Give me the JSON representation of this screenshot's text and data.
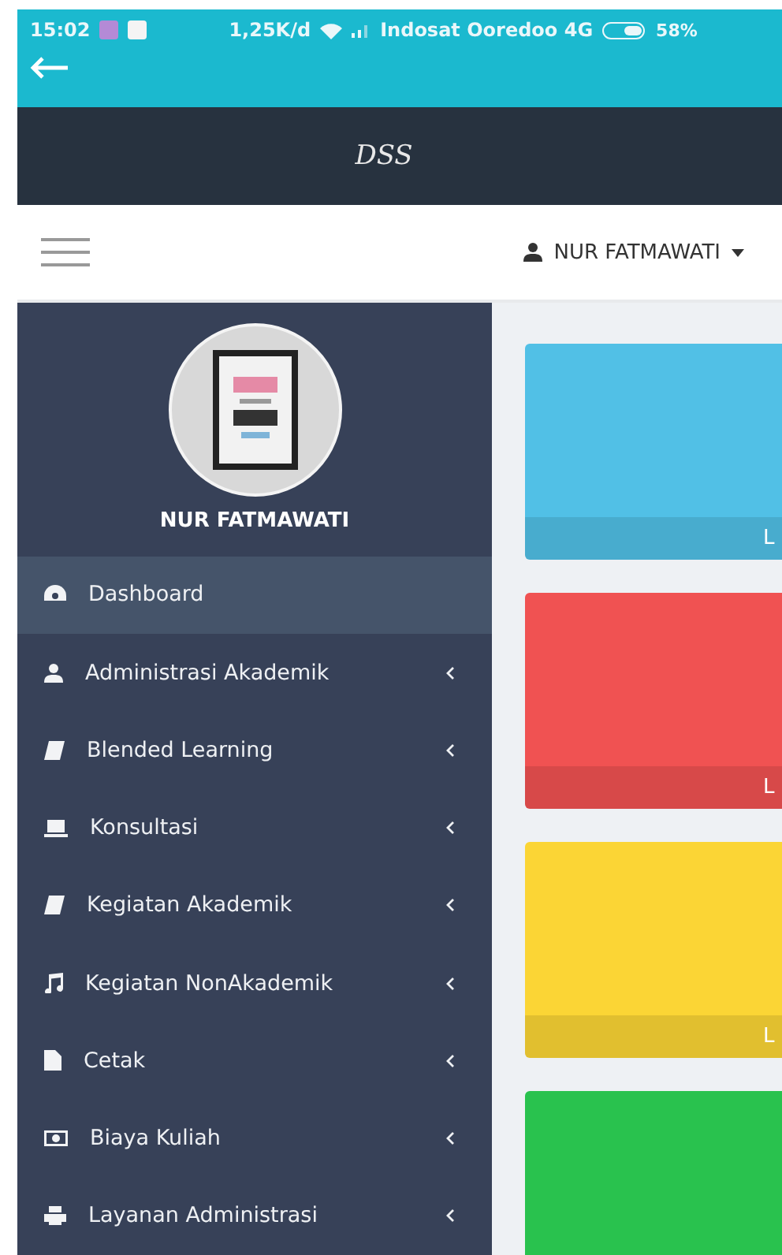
{
  "status_bar": {
    "time": "15:02",
    "speed": "1,25K/d",
    "carrier": "Indosat Ooredoo 4G",
    "battery": "58%"
  },
  "header": {
    "title": "DSS"
  },
  "navbar": {
    "user": "NUR FATMAWATI"
  },
  "sidebar": {
    "profile_name": "NUR FATMAWATI",
    "items": [
      {
        "label": "Dashboard",
        "selected": true,
        "expandable": false
      },
      {
        "label": "Administrasi Akademik",
        "selected": false,
        "expandable": true
      },
      {
        "label": "Blended Learning",
        "selected": false,
        "expandable": true
      },
      {
        "label": "Konsultasi",
        "selected": false,
        "expandable": true
      },
      {
        "label": "Kegiatan Akademik",
        "selected": false,
        "expandable": true
      },
      {
        "label": "Kegiatan NonAkademik",
        "selected": false,
        "expandable": true
      },
      {
        "label": "Cetak",
        "selected": false,
        "expandable": true
      },
      {
        "label": "Biaya Kuliah",
        "selected": false,
        "expandable": true
      },
      {
        "label": "Layanan Administrasi",
        "selected": false,
        "expandable": true
      }
    ]
  },
  "cards": [
    {
      "color": "#51c0e6",
      "footer": "L"
    },
    {
      "color": "#f05252",
      "footer": "L"
    },
    {
      "color": "#fbd535",
      "footer": "L"
    },
    {
      "color": "#29c24e"
    }
  ]
}
